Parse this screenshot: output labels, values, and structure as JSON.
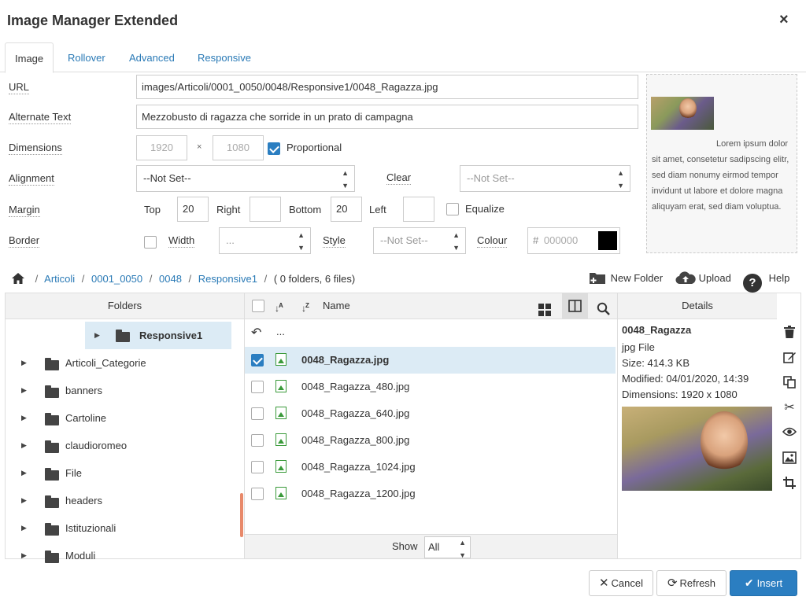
{
  "dialog": {
    "title": "Image Manager Extended",
    "close": "×"
  },
  "tabs": [
    {
      "label": "Image"
    },
    {
      "label": "Rollover"
    },
    {
      "label": "Advanced"
    },
    {
      "label": "Responsive"
    }
  ],
  "form": {
    "url_label": "URL",
    "url_value": "images/Articoli/0001_0050/0048/Responsive1/0048_Ragazza.jpg",
    "alt_label": "Alternate Text",
    "alt_value": "Mezzobusto di ragazza che sorride in un prato di campagna",
    "dimensions_label": "Dimensions",
    "width_value": "1920",
    "times": "×",
    "height_value": "1080",
    "proportional_label": "Proportional",
    "alignment_label": "Alignment",
    "alignment_value": "--Not Set--",
    "clear_label": "Clear",
    "clear_value": "--Not Set--",
    "margin_label": "Margin",
    "top_label": "Top",
    "top_value": "20",
    "right_label": "Right",
    "right_value": "",
    "bottom_label": "Bottom",
    "bottom_value": "20",
    "left_label": "Left",
    "left_value": "",
    "equalize_label": "Equalize",
    "border_label": "Border",
    "border_width_label": "Width",
    "border_width_value": "...",
    "border_style_label": "Style",
    "border_style_value": "--Not Set--",
    "colour_label": "Colour",
    "colour_hash": "#",
    "colour_value": "000000",
    "colour_swatch": "#000000"
  },
  "preview": {
    "text": "Lorem ipsum dolor sit amet, consetetur sadipscing elitr, sed diam nonumy eirmod tempor invidunt ut labore et dolore magna aliquyam erat, sed diam voluptua."
  },
  "breadcrumb": {
    "items": [
      "Articoli",
      "0001_0050",
      "0048",
      "Responsive1"
    ],
    "sep": "/",
    "summary": "( 0 folders, 6 files)"
  },
  "toolbar": {
    "new_folder": "New Folder",
    "upload": "Upload",
    "help": "Help"
  },
  "folders_panel": {
    "header": "Folders",
    "current": "Responsive1",
    "items": [
      "Articoli_Categorie",
      "banners",
      "Cartoline",
      "claudioromeo",
      "File",
      "headers",
      "Istituzionali",
      "Moduli"
    ]
  },
  "files_panel": {
    "name_header": "Name",
    "up_label": "...",
    "files": [
      {
        "name": "0048_Ragazza.jpg",
        "selected": true
      },
      {
        "name": "0048_Ragazza_480.jpg",
        "selected": false
      },
      {
        "name": "0048_Ragazza_640.jpg",
        "selected": false
      },
      {
        "name": "0048_Ragazza_800.jpg",
        "selected": false
      },
      {
        "name": "0048_Ragazza_1024.jpg",
        "selected": false
      },
      {
        "name": "0048_Ragazza_1200.jpg",
        "selected": false
      }
    ],
    "show_label": "Show",
    "show_value": "All"
  },
  "details_panel": {
    "header": "Details",
    "name": "0048_Ragazza",
    "type": "jpg File",
    "size": "Size: 414.3 KB",
    "modified": "Modified: 04/01/2020, 14:39",
    "dimensions": "Dimensions: 1920 x 1080"
  },
  "buttons": {
    "cancel": "Cancel",
    "refresh": "Refresh",
    "insert": "Insert"
  }
}
